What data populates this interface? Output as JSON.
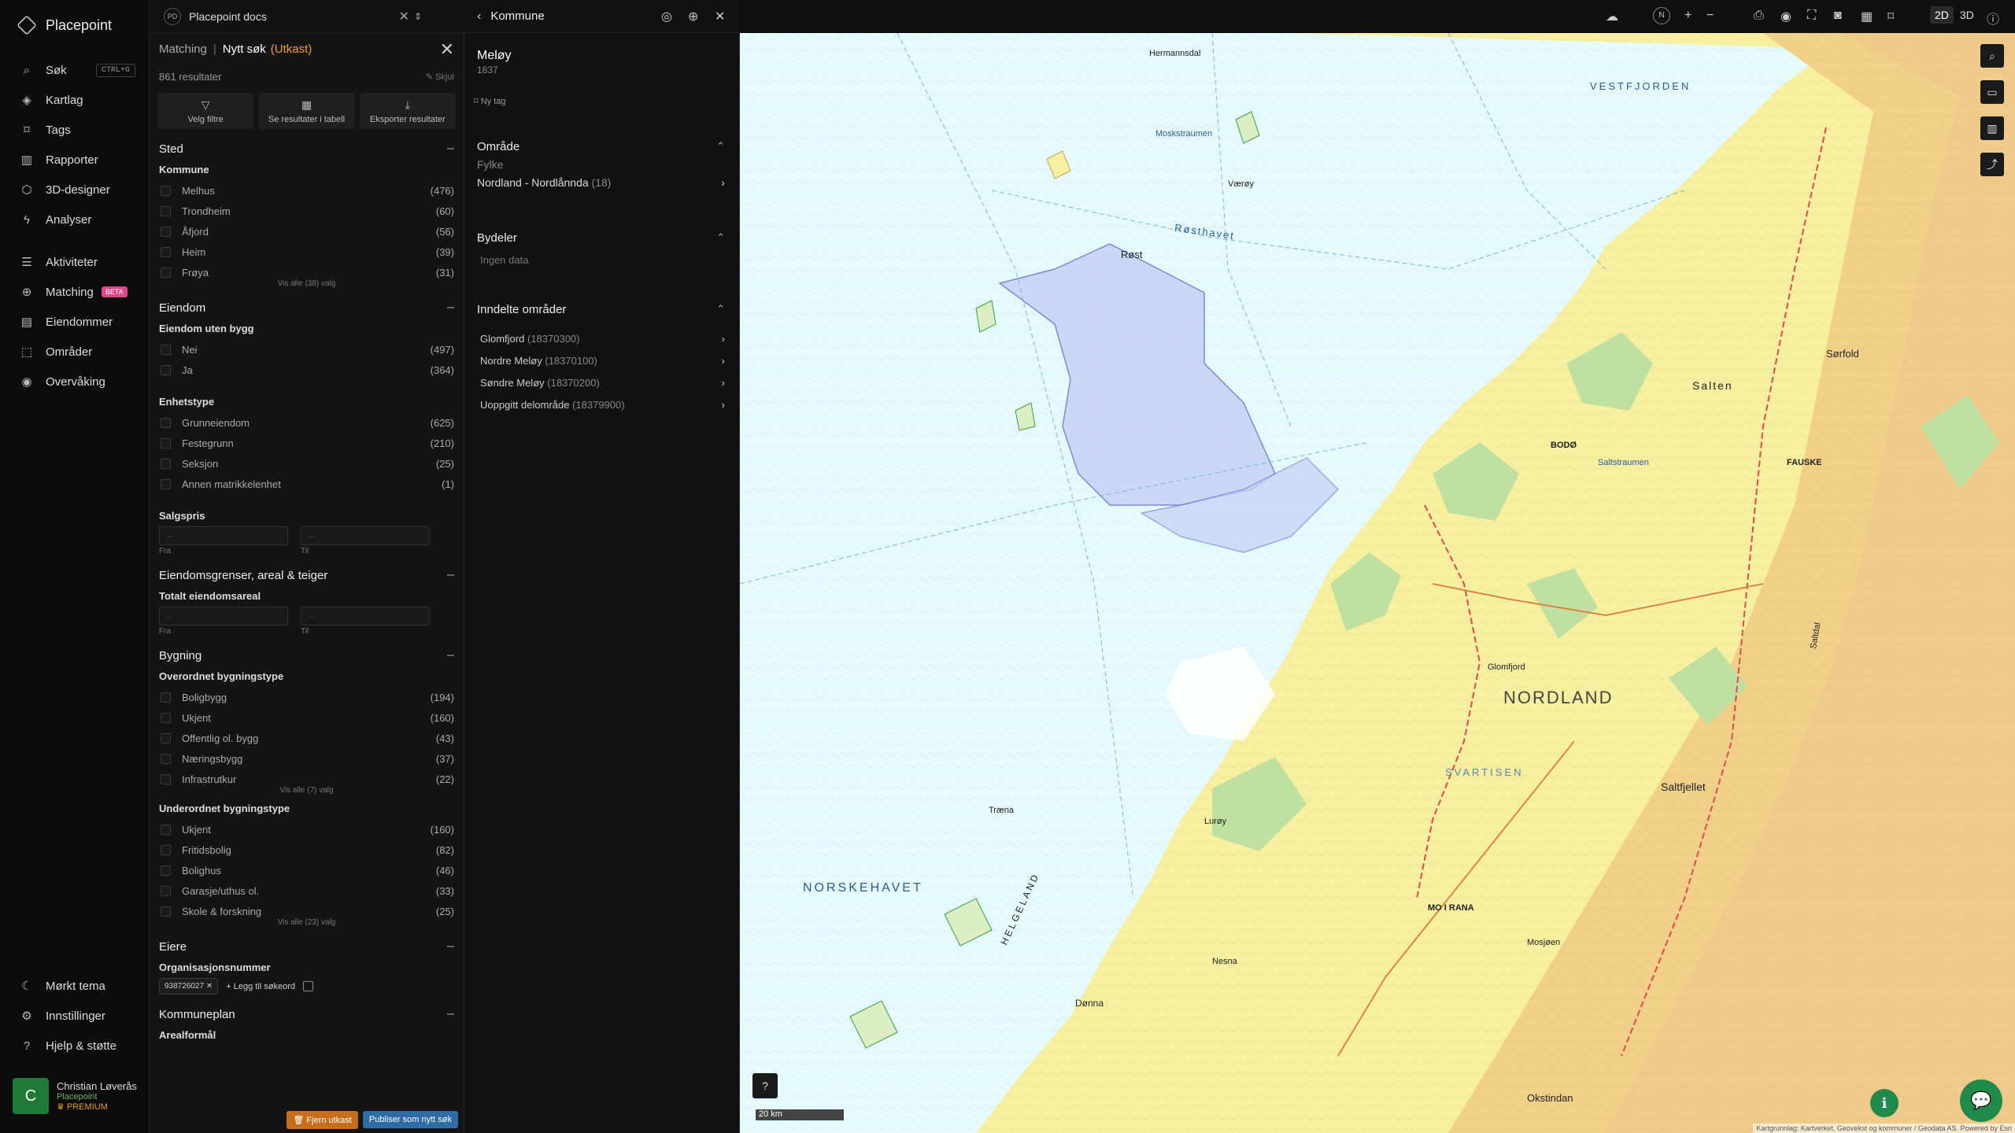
{
  "app": {
    "name": "Placepoint"
  },
  "nav": {
    "items": [
      {
        "key": "search",
        "label": "Søk",
        "shortcut": "CTRL+G",
        "icon": "search-icon"
      },
      {
        "key": "kartlag",
        "label": "Kartlag",
        "icon": "layers-icon"
      },
      {
        "key": "tags",
        "label": "Tags",
        "icon": "bookmark-icon"
      },
      {
        "key": "rapporter",
        "label": "Rapporter",
        "icon": "bar-chart-icon"
      },
      {
        "key": "3d",
        "label": "3D-designer",
        "icon": "cube-icon"
      },
      {
        "key": "analyser",
        "label": "Analyser",
        "icon": "bolt-icon"
      },
      {
        "key": "aktiviteter",
        "label": "Aktiviteter",
        "icon": "activity-icon"
      },
      {
        "key": "matching",
        "label": "Matching",
        "badge": "BETA",
        "icon": "matching-icon"
      },
      {
        "key": "eiendommer",
        "label": "Eiendommer",
        "icon": "building-icon"
      },
      {
        "key": "omrader",
        "label": "Områder",
        "icon": "area-icon"
      },
      {
        "key": "overvaking",
        "label": "Overvåking",
        "icon": "monitor-icon"
      }
    ],
    "bottom": [
      {
        "key": "dark",
        "label": "Mørkt tema",
        "icon": "moon-icon"
      },
      {
        "key": "settings",
        "label": "Innstillinger",
        "icon": "gear-icon"
      },
      {
        "key": "help",
        "label": "Hjelp & støtte",
        "icon": "help-icon"
      }
    ]
  },
  "user": {
    "initial": "C",
    "name": "Christian Løverås",
    "org": "Placepoint",
    "plan": "PREMIUM"
  },
  "doc": {
    "badge": "PD",
    "name": "Placepoint docs"
  },
  "panel": {
    "crumb": "Matching",
    "title": "Nytt søk",
    "draft": "(Utkast)",
    "results": "861 resultater",
    "hide": "Skjul",
    "actions": [
      {
        "label": "Velg filtre"
      },
      {
        "label": "Se resultater i tabell"
      },
      {
        "label": "Eksporter resultater"
      }
    ],
    "sted": {
      "title": "Sted",
      "sub": "Kommune",
      "rows": [
        {
          "label": "Melhus",
          "count": "(476)"
        },
        {
          "label": "Trondheim",
          "count": "(60)"
        },
        {
          "label": "Åfjord",
          "count": "(56)"
        },
        {
          "label": "Heim",
          "count": "(39)"
        },
        {
          "label": "Frøya",
          "count": "(31)"
        }
      ],
      "more": "Vis alle (38) valg"
    },
    "eiendom": {
      "title": "Eiendom",
      "sub1": "Eiendom uten bygg",
      "rows1": [
        {
          "label": "Nei",
          "count": "(497)"
        },
        {
          "label": "Ja",
          "count": "(364)"
        }
      ],
      "sub2": "Enhetstype",
      "rows2": [
        {
          "label": "Grunneiendom",
          "count": "(625)"
        },
        {
          "label": "Festegrunn",
          "count": "(210)"
        },
        {
          "label": "Seksjon",
          "count": "(25)"
        },
        {
          "label": "Annen matrikkelenhet",
          "count": "(1)"
        }
      ],
      "sub3": "Salgspris",
      "from": "Fra",
      "to": "Til",
      "ph": "..."
    },
    "grenser": {
      "title": "Eiendomsgrenser, areal & teiger",
      "sub": "Totalt eiendomsareal",
      "from": "Fra",
      "to": "Til",
      "ph": "..."
    },
    "bygning": {
      "title": "Bygning",
      "sub1": "Overordnet bygningstype",
      "rows1": [
        {
          "label": "Boligbygg",
          "count": "(194)"
        },
        {
          "label": "Ukjent",
          "count": "(160)"
        },
        {
          "label": "Offentlig ol. bygg",
          "count": "(43)"
        },
        {
          "label": "Næringsbygg",
          "count": "(37)"
        },
        {
          "label": "Infrastrutkur",
          "count": "(22)"
        }
      ],
      "more1": "Vis alle (7) valg",
      "sub2": "Underordnet bygningstype",
      "rows2": [
        {
          "label": "Ukjent",
          "count": "(160)"
        },
        {
          "label": "Fritidsbolig",
          "count": "(82)"
        },
        {
          "label": "Bolighus",
          "count": "(46)"
        },
        {
          "label": "Garasje/uthus ol.",
          "count": "(33)"
        },
        {
          "label": "Skole & forskning",
          "count": "(25)"
        }
      ],
      "more2": "Vis alle (23) valg"
    },
    "eiere": {
      "title": "Eiere",
      "sub": "Organisasjonsnummer",
      "chip": "938726027",
      "add": "Legg til søkeord"
    },
    "kommuneplan": {
      "title": "Kommuneplan",
      "sub": "Arealformål"
    },
    "footer": {
      "remove": "Fjern utkast",
      "publish": "Publiser som nytt søk"
    }
  },
  "detail": {
    "header": "Kommune",
    "name": "Meløy",
    "code": "1837",
    "tag": "Ny tag",
    "omrade": {
      "title": "Område",
      "label": "Fylke",
      "link": "Nordland - Nordlånnda",
      "count": "(18)"
    },
    "bydeler": {
      "title": "Bydeler",
      "empty": "Ingen data"
    },
    "inndelte": {
      "title": "Inndelte områder",
      "items": [
        {
          "label": "Glomfjord",
          "code": "(18370300)"
        },
        {
          "label": "Nordre Meløy",
          "code": "(18370100)"
        },
        {
          "label": "Søndre Meløy",
          "code": "(18370200)"
        },
        {
          "label": "Uoppgitt delområde",
          "code": "(18379900)"
        }
      ]
    }
  },
  "map": {
    "modes": [
      "2D",
      "3D"
    ],
    "scale": "20 km",
    "attribution": "Kartgrunnlag: Kartverket, Geovekst og kommuner / Geodata AS. Powered by Esri",
    "labels": {
      "sea1": "NORSKEHAVET",
      "sea2": "VESTFJORDEN",
      "region": "NORDLAND",
      "svartisen": "SVARTISEN",
      "motrana": "MO I RANA",
      "bodo": "BODØ",
      "fauske": "FAUSKE",
      "rost": "Røst",
      "vaeroy": "Værøy",
      "moskenes": "Moskstraumen",
      "saltfjellet": "Saltfjellet",
      "saltdal": "Saltdal",
      "helgeland": "HELGELAND",
      "traena": "Træna",
      "lurøy": "Lurøy",
      "dønna": "Dønna",
      "nesna": "Nesna",
      "sorfold": "Sørfold",
      "salten": "Salten",
      "glomfjord": "Glomfjord",
      "stokmarknes": "Hermannsdal",
      "mosjoen": "Mosjøen",
      "okstindan": "Okstindan",
      "rosthavet": "Røsthavet",
      "saltstraumen": "Saltstraumen"
    }
  }
}
